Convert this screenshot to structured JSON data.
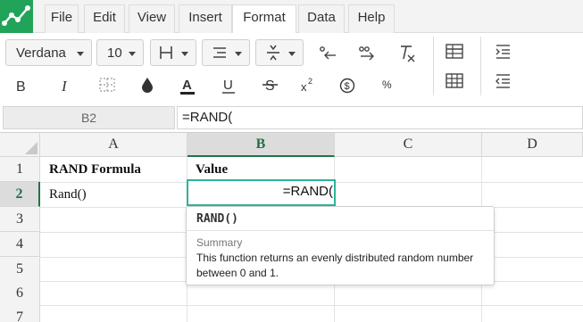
{
  "menu": {
    "items": [
      {
        "label": "File"
      },
      {
        "label": "Edit"
      },
      {
        "label": "View"
      },
      {
        "label": "Insert"
      },
      {
        "label": "Format"
      },
      {
        "label": "Data"
      },
      {
        "label": "Help"
      }
    ],
    "active": "Format"
  },
  "toolbar": {
    "font_family": "Verdana",
    "font_size": "10",
    "percent_label": "%",
    "icons": [
      "border-icon",
      "align-icon",
      "vertical-align-icon",
      "decrease-decimal-icon",
      "increase-decimal-icon",
      "clear-format-icon",
      "bold-icon",
      "italic-icon",
      "borders-none-icon",
      "fill-color-icon",
      "text-color-icon",
      "underline-icon",
      "strikethrough-icon",
      "superscript-icon",
      "currency-icon",
      "table-icon",
      "grid-icon",
      "indent-icon",
      "outdent-icon"
    ],
    "accent_color": "#217346"
  },
  "formula_bar": {
    "cell_ref": "B2",
    "value": "=RAND("
  },
  "grid": {
    "columns": [
      "A",
      "B",
      "C",
      "D"
    ],
    "rows": [
      "1",
      "2",
      "3",
      "4",
      "5",
      "6",
      "7"
    ],
    "selected_column": "B",
    "selected_row": "2",
    "cells": {
      "A1": "RAND Formula",
      "B1": "Value",
      "A2": "Rand()",
      "B2": "=RAND("
    }
  },
  "tooltip": {
    "signature": "RAND()",
    "summary_label": "Summary",
    "description": "This function returns an evenly distributed random number between 0 and 1."
  },
  "colors": {
    "logo": "#22a35a",
    "selection_border": "#2bb39a",
    "header_selected_text": "#217346"
  }
}
